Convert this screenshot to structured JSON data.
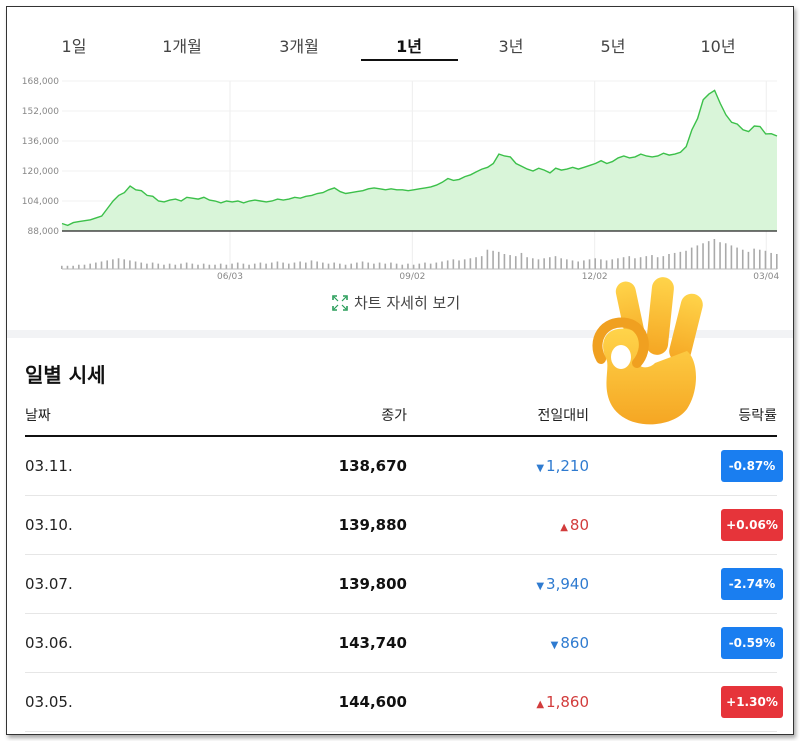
{
  "tabs": [
    {
      "label": "1일",
      "active": false
    },
    {
      "label": "1개월",
      "active": false
    },
    {
      "label": "3개월",
      "active": false
    },
    {
      "label": "1년",
      "active": true
    },
    {
      "label": "3년",
      "active": false
    },
    {
      "label": "5년",
      "active": false
    },
    {
      "label": "10년",
      "active": false
    }
  ],
  "chart_data": {
    "type": "area",
    "line_color": "#3cc04a",
    "fill_color": "#d9f5d9",
    "ylim": [
      88000,
      168000
    ],
    "y_ticks": [
      "168,000",
      "152,000",
      "136,000",
      "120,000",
      "104,000",
      "88,000"
    ],
    "x_ticks": [
      "06/03",
      "09/02",
      "12/02",
      "03/04"
    ],
    "values": [
      92000,
      91000,
      92500,
      93000,
      93500,
      94000,
      95000,
      96000,
      100000,
      104000,
      107000,
      108500,
      112000,
      110000,
      109500,
      107000,
      106500,
      104000,
      103500,
      104500,
      105000,
      104000,
      106000,
      105500,
      105000,
      106000,
      104500,
      104000,
      103000,
      104000,
      103500,
      104000,
      103000,
      104000,
      104500,
      104000,
      103500,
      104000,
      105000,
      104500,
      105000,
      106000,
      105500,
      106500,
      107000,
      108000,
      108500,
      110000,
      111000,
      109000,
      108000,
      108500,
      109000,
      109500,
      110500,
      111000,
      110500,
      110000,
      110500,
      110000,
      110000,
      109500,
      110000,
      110500,
      111000,
      111500,
      112500,
      114000,
      116000,
      115000,
      115500,
      117000,
      118000,
      119500,
      121000,
      122000,
      124000,
      129000,
      128000,
      127500,
      124000,
      122500,
      121000,
      120000,
      121500,
      120500,
      119000,
      121500,
      120500,
      121000,
      122000,
      121000,
      122000,
      123000,
      124000,
      125500,
      124000,
      125000,
      127000,
      128000,
      127000,
      127500,
      129000,
      128000,
      127500,
      128000,
      129500,
      128500,
      129000,
      130000,
      133000,
      142000,
      148000,
      158000,
      161000,
      163000,
      156000,
      150000,
      146000,
      145000,
      142000,
      141000,
      144000,
      143740,
      139800,
      139880,
      138670
    ],
    "volume": [
      3,
      3,
      3,
      4,
      4,
      5,
      6,
      7,
      8,
      9,
      10,
      9,
      8,
      7,
      6,
      5,
      6,
      5,
      4,
      5,
      4,
      5,
      6,
      5,
      4,
      5,
      4,
      4,
      5,
      4,
      5,
      6,
      5,
      4,
      5,
      6,
      5,
      6,
      7,
      6,
      5,
      6,
      7,
      6,
      8,
      7,
      6,
      5,
      6,
      5,
      4,
      5,
      6,
      7,
      6,
      5,
      6,
      5,
      6,
      5,
      4,
      5,
      4,
      5,
      6,
      5,
      6,
      7,
      8,
      9,
      8,
      9,
      10,
      11,
      12,
      18,
      17,
      16,
      14,
      13,
      12,
      15,
      11,
      10,
      9,
      10,
      11,
      12,
      10,
      9,
      8,
      7,
      8,
      9,
      10,
      9,
      8,
      9,
      10,
      11,
      12,
      10,
      11,
      12,
      13,
      11,
      12,
      14,
      15,
      16,
      17,
      20,
      22,
      24,
      26,
      28,
      25,
      24,
      22,
      20,
      18,
      16,
      19,
      18,
      17,
      15,
      14
    ]
  },
  "detail_link_label": "차트 자세히 보기",
  "section_title": "일별 시세",
  "table": {
    "headers": {
      "date": "날짜",
      "close": "종가",
      "change": "전일대비",
      "rate": "등락률"
    },
    "rows": [
      {
        "date": "03.11.",
        "close": "138,670",
        "change": "1,210",
        "direction": "down",
        "rate": "-0.87%"
      },
      {
        "date": "03.10.",
        "close": "139,880",
        "change": "80",
        "direction": "up",
        "rate": "+0.06%"
      },
      {
        "date": "03.07.",
        "close": "139,800",
        "change": "3,940",
        "direction": "down",
        "rate": "-2.74%"
      },
      {
        "date": "03.06.",
        "close": "143,740",
        "change": "860",
        "direction": "down",
        "rate": "-0.59%"
      },
      {
        "date": "03.05.",
        "close": "144,600",
        "change": "1,860",
        "direction": "up",
        "rate": "+1.30%"
      }
    ]
  },
  "overlay_icon": "ok-hand-emoji"
}
